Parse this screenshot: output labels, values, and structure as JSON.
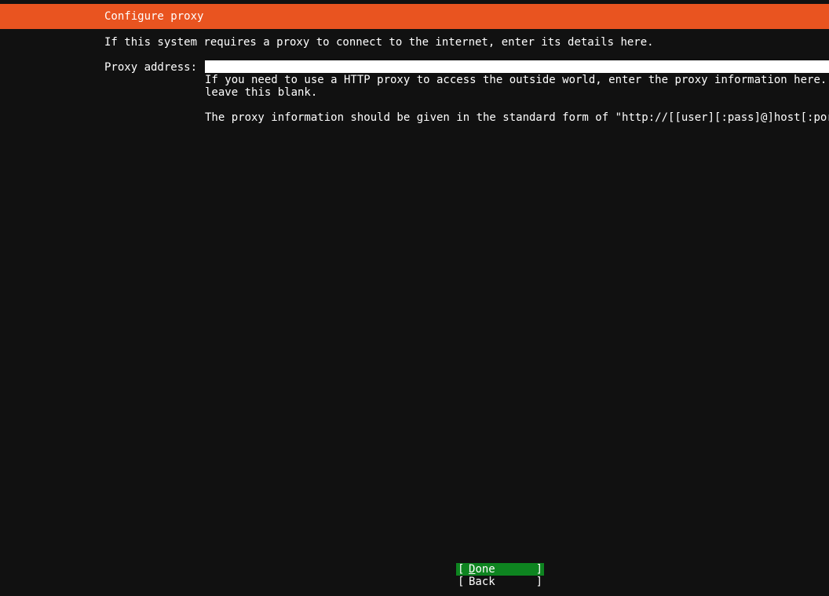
{
  "header": {
    "title": "Configure proxy"
  },
  "intro_text": "If this system requires a proxy to connect to the internet, enter its details here.",
  "proxy": {
    "label": "Proxy address:",
    "value": "",
    "help_line1": "If you need to use a HTTP proxy to access the outside world, enter the proxy information here. Othe",
    "help_line2": "leave this blank.",
    "help_line3": "The proxy information should be given in the standard form of \"http://[[user][:pass]@]host[:port]/\""
  },
  "buttons": {
    "left_bracket": "[",
    "right_bracket": "]",
    "done_label": "Done",
    "back_label": "Back"
  },
  "colors": {
    "header_bg": "#e95420",
    "focused_button_bg": "#0e8420",
    "background": "#111111"
  }
}
